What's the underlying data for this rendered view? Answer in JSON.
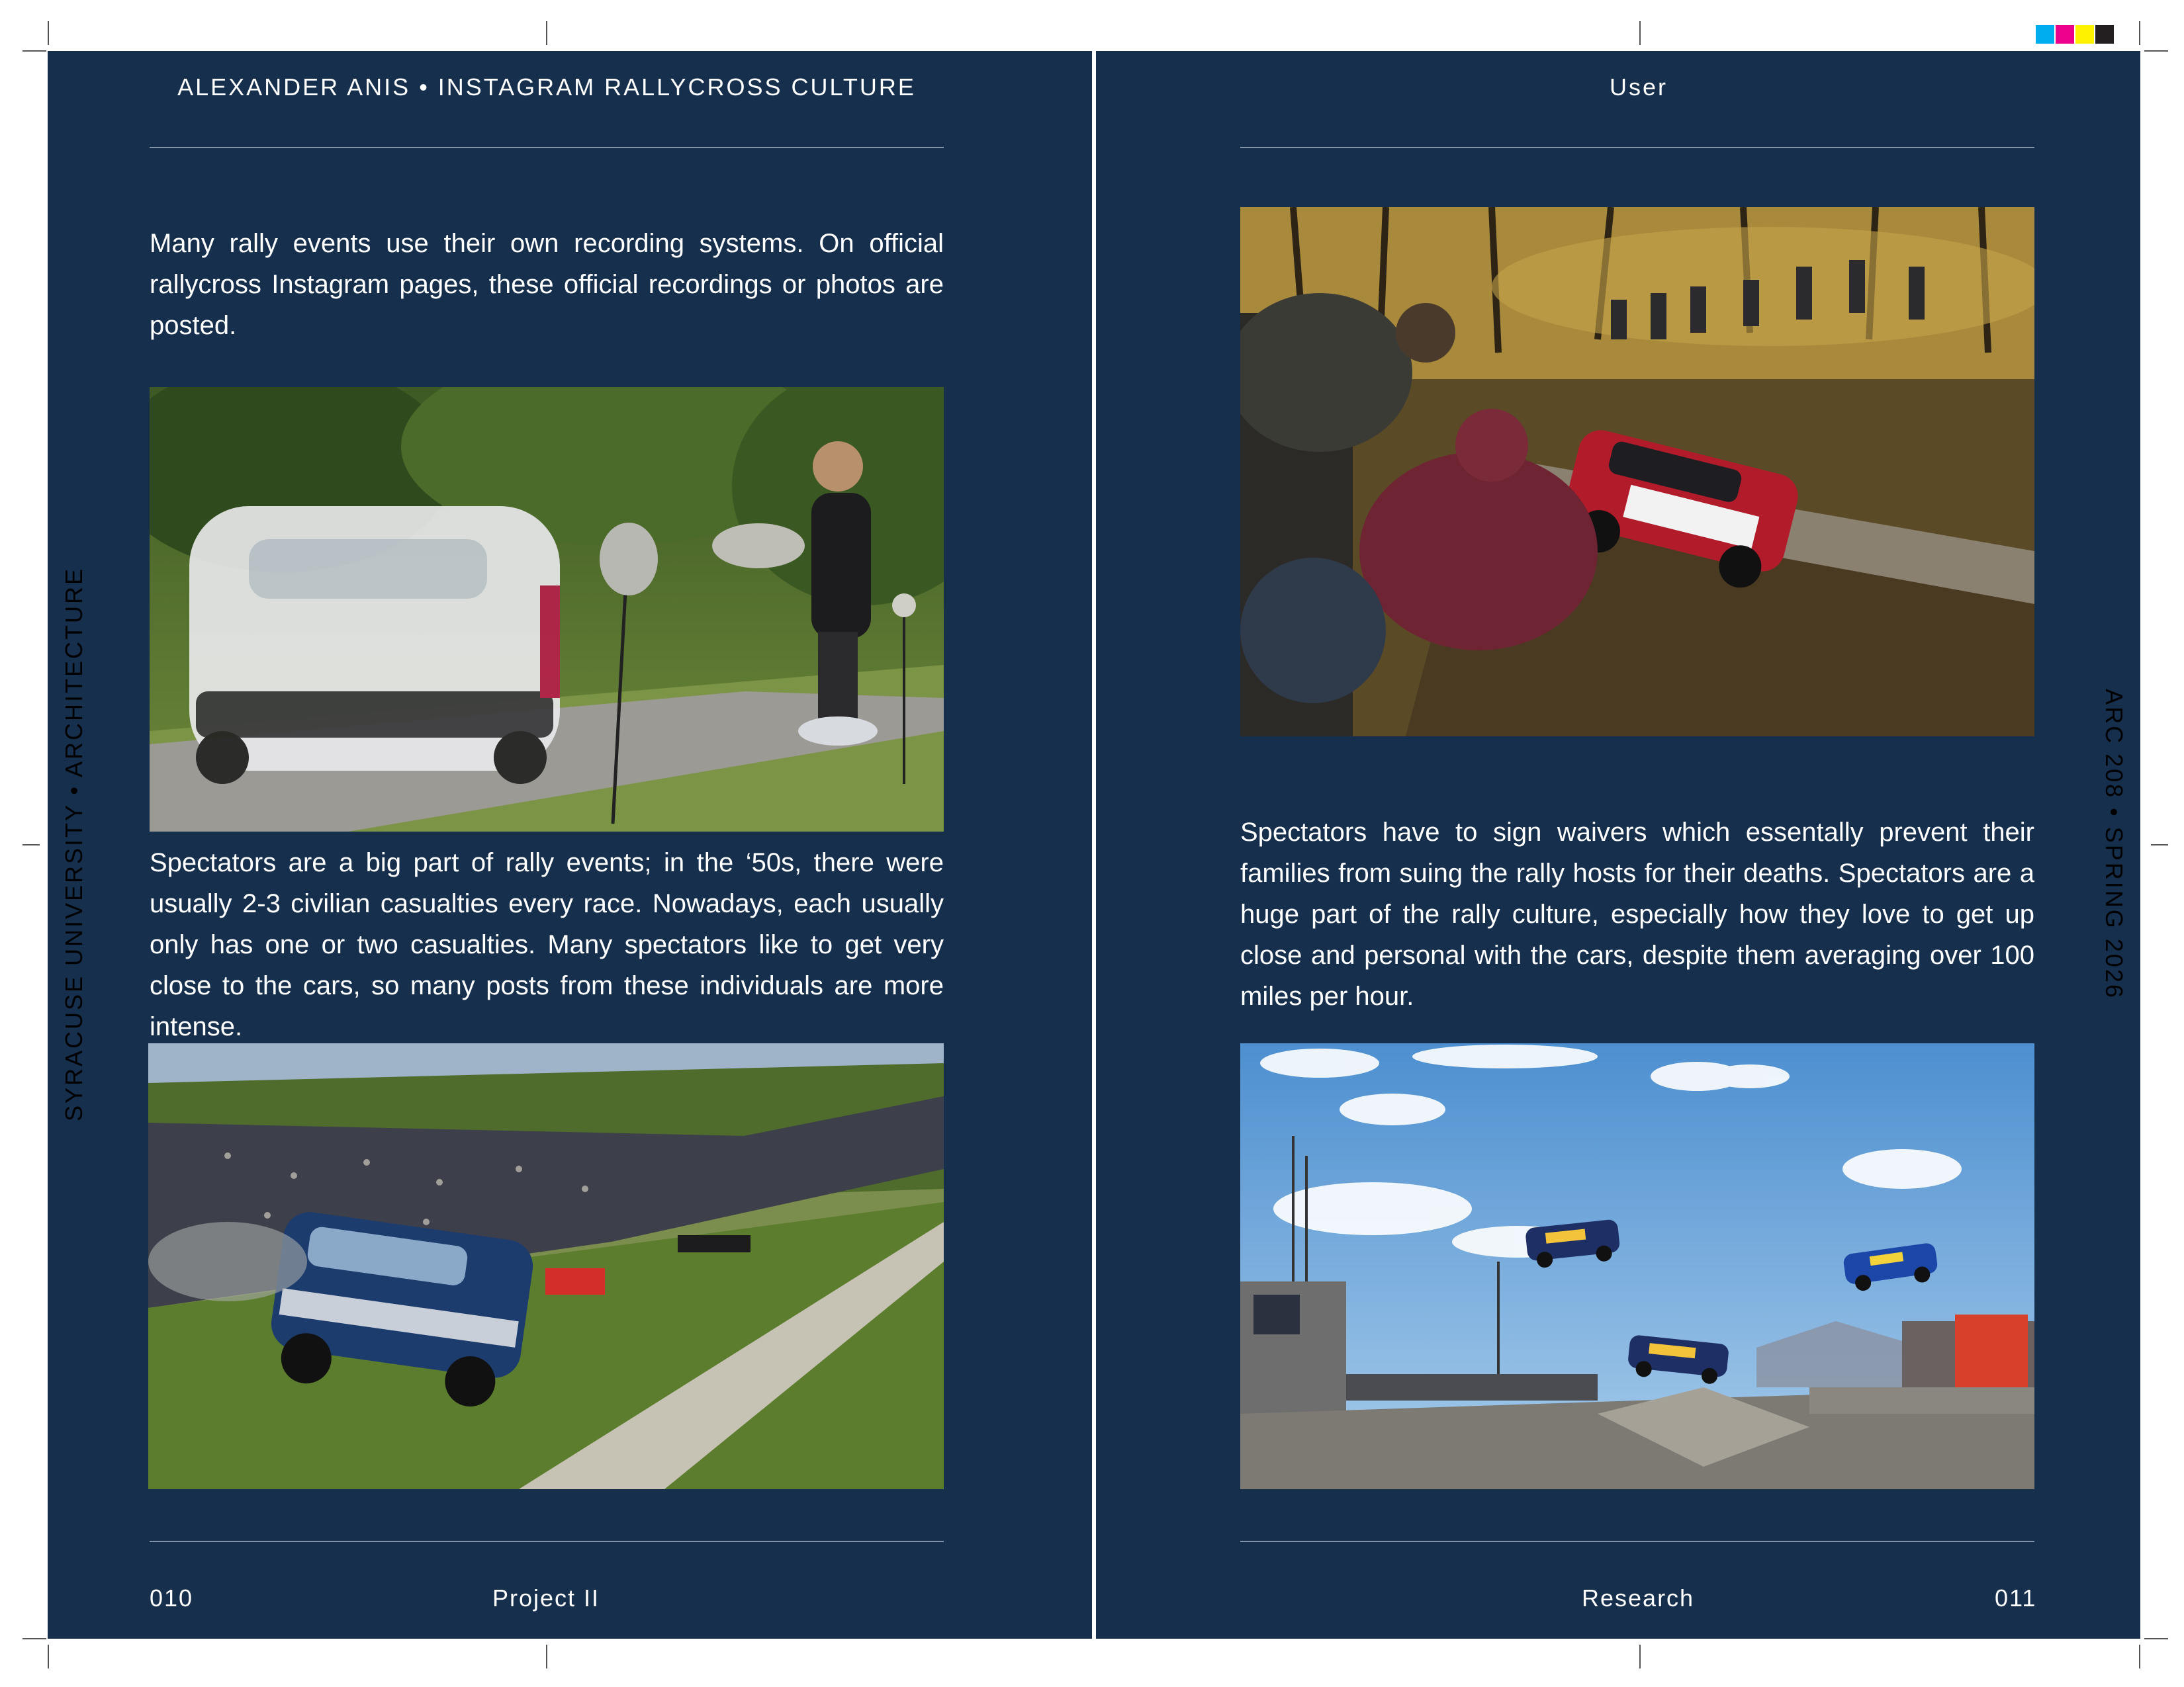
{
  "left_page": {
    "header": "ALEXANDER ANIS • INSTAGRAM RALLYCROSS CULTURE",
    "paragraph_1": "Many rally events use their own recording systems. On official rallycross Instagram pages, these official recordings or photos are posted.",
    "paragraph_2": "Spectators are a big part of rally events; in the ‘50s, there were usually 2-3 civilian casualties every race. Nowadays, each usually only has one or two casualties. Many spectators like to get very close to the cars, so many posts from these individuals are more intense.",
    "page_number": "010",
    "section": "Project II",
    "side_label": "SYRACUSE UNIVERSITY • ARCHITECTURE"
  },
  "right_page": {
    "header": "User",
    "paragraph_1": "Spectators have to sign waivers which essentally prevent their families from suing the rally hosts for their deaths. Spectators are a huge part of the rally culture, especially how they love to get up close and personal with the cars, despite them averaging over 100 miles per hour.",
    "page_number": "011",
    "section": "Research",
    "side_label": "ARC 208 • SPRING 2026"
  },
  "photos": [
    {
      "id": "rally-car-microphones",
      "subject": "white rally car passing roadside recording microphones"
    },
    {
      "id": "jumping-rally-car-crowd",
      "subject": "rally car jumping in front of a large crowd"
    },
    {
      "id": "forest-spectators",
      "subject": "spectators crouching beside a rally car on a forest track"
    },
    {
      "id": "rallycross-jumps",
      "subject": "rallycross cars jumping over a track ramp"
    }
  ],
  "colors": {
    "page_background": "#162f4d",
    "text": "#ffffff",
    "rule": "#8394a8",
    "swatches": [
      "#00aeef",
      "#ec008c",
      "#fff200",
      "#231f20"
    ]
  }
}
